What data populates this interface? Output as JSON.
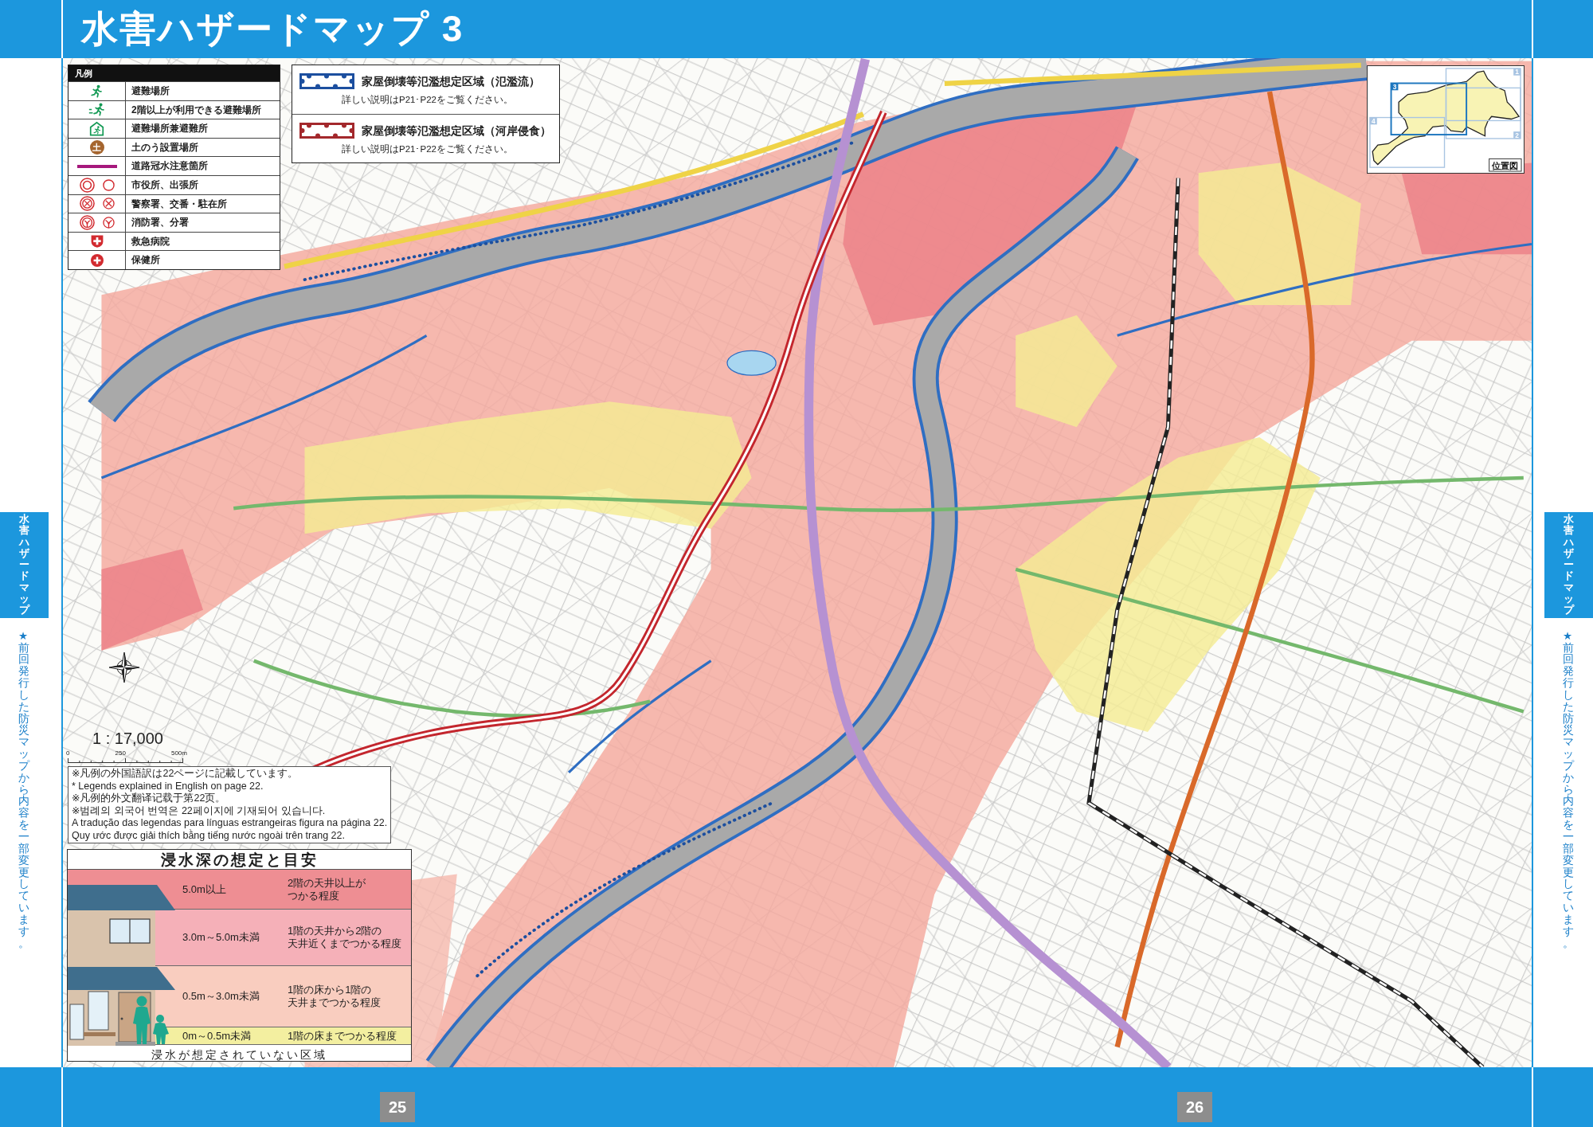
{
  "header": {
    "title": "水害ハザードマップ 3"
  },
  "side_tabs": [
    {
      "label": "水害ハザードマップ",
      "note": "★前回発行した防災マップから内容を一部変更しています。"
    },
    {
      "label": "水害ハザードマップ",
      "note": "★前回発行した防災マップから内容を一部変更しています。"
    }
  ],
  "legend": {
    "title": "凡例",
    "items": [
      {
        "kind": "shelter",
        "label": "避難場所"
      },
      {
        "kind": "upper_floor_shelter",
        "label": "2階以上が利用できる避難場所"
      },
      {
        "kind": "shelter_refuge",
        "label": "避難場所兼避難所"
      },
      {
        "kind": "sandbag",
        "symbol": "土",
        "label": "土のう設置場所"
      },
      {
        "kind": "road_flooding",
        "label": "道路冠水注意箇所"
      },
      {
        "kind": "city_office",
        "label": "市役所、出張所"
      },
      {
        "kind": "police",
        "label": "警察署、交番・駐在所"
      },
      {
        "kind": "fire",
        "label": "消防署、分署"
      },
      {
        "kind": "emergency_hospital",
        "label": "救急病院"
      },
      {
        "kind": "health_center",
        "label": "保健所"
      }
    ]
  },
  "hazard_zones": [
    {
      "color": "#1c4f9f",
      "title": "家屋倒壊等氾濫想定区域（氾濫流）",
      "note": "詳しい説明はP21･P22をご覧ください。"
    },
    {
      "color": "#a3282c",
      "title": "家屋倒壊等氾濫想定区域（河岸侵食）",
      "note": "詳しい説明はP21･P22をご覧ください。"
    }
  ],
  "locator": {
    "title": "位置図",
    "sheets": [
      {
        "number": "1",
        "selected": false
      },
      {
        "number": "2",
        "selected": false
      },
      {
        "number": "3",
        "selected": true
      },
      {
        "number": "4",
        "selected": false
      }
    ]
  },
  "scale": {
    "ratio": "1 : 17,000",
    "labels": [
      "0",
      "250",
      "500m"
    ]
  },
  "notes": [
    "※凡例の外国語訳は22ページに記載しています。",
    "* Legends explained in English on page 22.",
    "※凡例的外文翻译记载于第22页。",
    "※범례의 외국어 번역은 22페이지에 기재되어 있습니다.",
    "A tradução das legendas para línguas estrangeiras figura na página 22.",
    "Quy ước được giải thích bằng tiếng nước ngoài trên trang 22."
  ],
  "depth_table": {
    "title": "浸水深の想定と目安",
    "levels": [
      {
        "depth": "5.0m以上",
        "description": [
          "2階の天井以上が",
          "つかる程度"
        ],
        "color": "#ee8e93"
      },
      {
        "depth": "3.0m～5.0m未満",
        "description": [
          "1階の天井から2階の",
          "天井近くまでつかる程度"
        ],
        "color": "#f5b0b8"
      },
      {
        "depth": "0.5m～3.0m未満",
        "description": [
          "1階の床から1階の",
          "天井までつかる程度"
        ],
        "color": "#f9cdbf"
      },
      {
        "depth": "0m～0.5m未満",
        "description": [
          "1階の床までつかる程度"
        ],
        "color": "#f3efa0"
      }
    ],
    "no_flood": "浸水が想定されていない区域"
  },
  "footer": {
    "pages": [
      "25",
      "26"
    ]
  }
}
